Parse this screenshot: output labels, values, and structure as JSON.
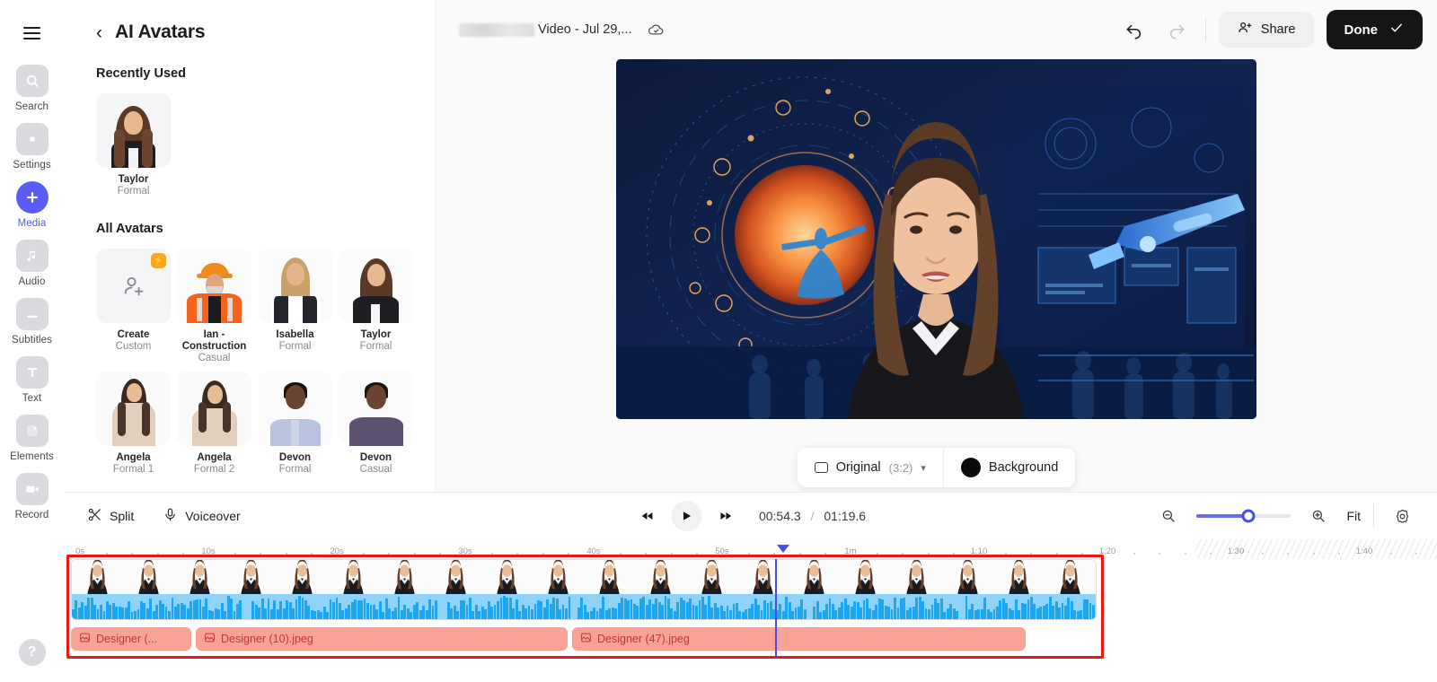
{
  "rail": {
    "menu_icon": "hamburger-icon",
    "items": [
      {
        "label": "Search",
        "icon": "search-icon",
        "active": false
      },
      {
        "label": "Settings",
        "icon": "gear-icon",
        "active": false
      },
      {
        "label": "Media",
        "icon": "plus-icon",
        "active": true
      },
      {
        "label": "Audio",
        "icon": "music-note-icon",
        "active": false
      },
      {
        "label": "Subtitles",
        "icon": "subtitles-icon",
        "active": false
      },
      {
        "label": "Text",
        "icon": "text-t-icon",
        "active": false
      },
      {
        "label": "Elements",
        "icon": "elements-icon",
        "active": false
      },
      {
        "label": "Record",
        "icon": "video-camera-icon",
        "active": false
      }
    ],
    "help_label": "?"
  },
  "panel": {
    "back_icon": "chevron-left-icon",
    "title": "AI Avatars",
    "recently_used_heading": "Recently Used",
    "all_avatars_heading": "All Avatars",
    "recently_used": [
      {
        "name": "Taylor",
        "style": "Formal"
      }
    ],
    "avatars": [
      {
        "name": "Create",
        "style": "Custom",
        "badge": "bolt-icon",
        "is_create": true
      },
      {
        "name": "Ian - Construction",
        "style": "Casual"
      },
      {
        "name": "Isabella",
        "style": "Formal"
      },
      {
        "name": "Taylor",
        "style": "Formal"
      },
      {
        "name": "Angela",
        "style": "Formal 1"
      },
      {
        "name": "Angela",
        "style": "Formal 2"
      },
      {
        "name": "Devon",
        "style": "Formal"
      },
      {
        "name": "Devon",
        "style": "Casual"
      }
    ]
  },
  "topbar": {
    "redacted_name": "",
    "project_title": "Video - Jul 29,...",
    "cloud_icon": "cloud-check-icon",
    "undo_icon": "undo-arrow-icon",
    "redo_icon": "redo-arrow-icon",
    "share_label": "Share",
    "share_icon": "person-plus-icon",
    "done_label": "Done",
    "done_icon": "check-icon"
  },
  "preview_controls": {
    "ratio_icon": "rectangle-icon",
    "ratio_label": "Original",
    "ratio_value": "(3:2)",
    "ratio_chevron": "chevron-down-icon",
    "background_label": "Background",
    "background_color": "#0a0a0a"
  },
  "timeline": {
    "split_label": "Split",
    "split_icon": "scissors-icon",
    "voiceover_label": "Voiceover",
    "voiceover_icon": "microphone-icon",
    "rewind_icon": "rewind-icon",
    "play_icon": "play-icon",
    "forward_icon": "fast-forward-icon",
    "current_time": "00:54.3",
    "time_separator": "/",
    "total_time": "01:19.6",
    "zoom_out_icon": "zoom-out-icon",
    "zoom_in_icon": "zoom-in-icon",
    "zoom_value": 55,
    "fit_label": "Fit",
    "settings_icon": "gear-icon",
    "ruler_ticks": [
      "0s",
      "10s",
      "20s",
      "30s",
      "40s",
      "50s",
      "1m",
      "1:10",
      "1:20",
      "1:30",
      "1:40"
    ],
    "playhead_time": "00:54.3",
    "image_clips": [
      {
        "label": "Designer (...",
        "icon": "image-icon"
      },
      {
        "label": "Designer (10).jpeg",
        "icon": "image-icon"
      },
      {
        "label": "Designer (47).jpeg",
        "icon": "image-icon"
      }
    ],
    "selection_color": "#F01414",
    "accent_color": "#4B4BF0",
    "waveform_color": "#1CA7F0"
  }
}
